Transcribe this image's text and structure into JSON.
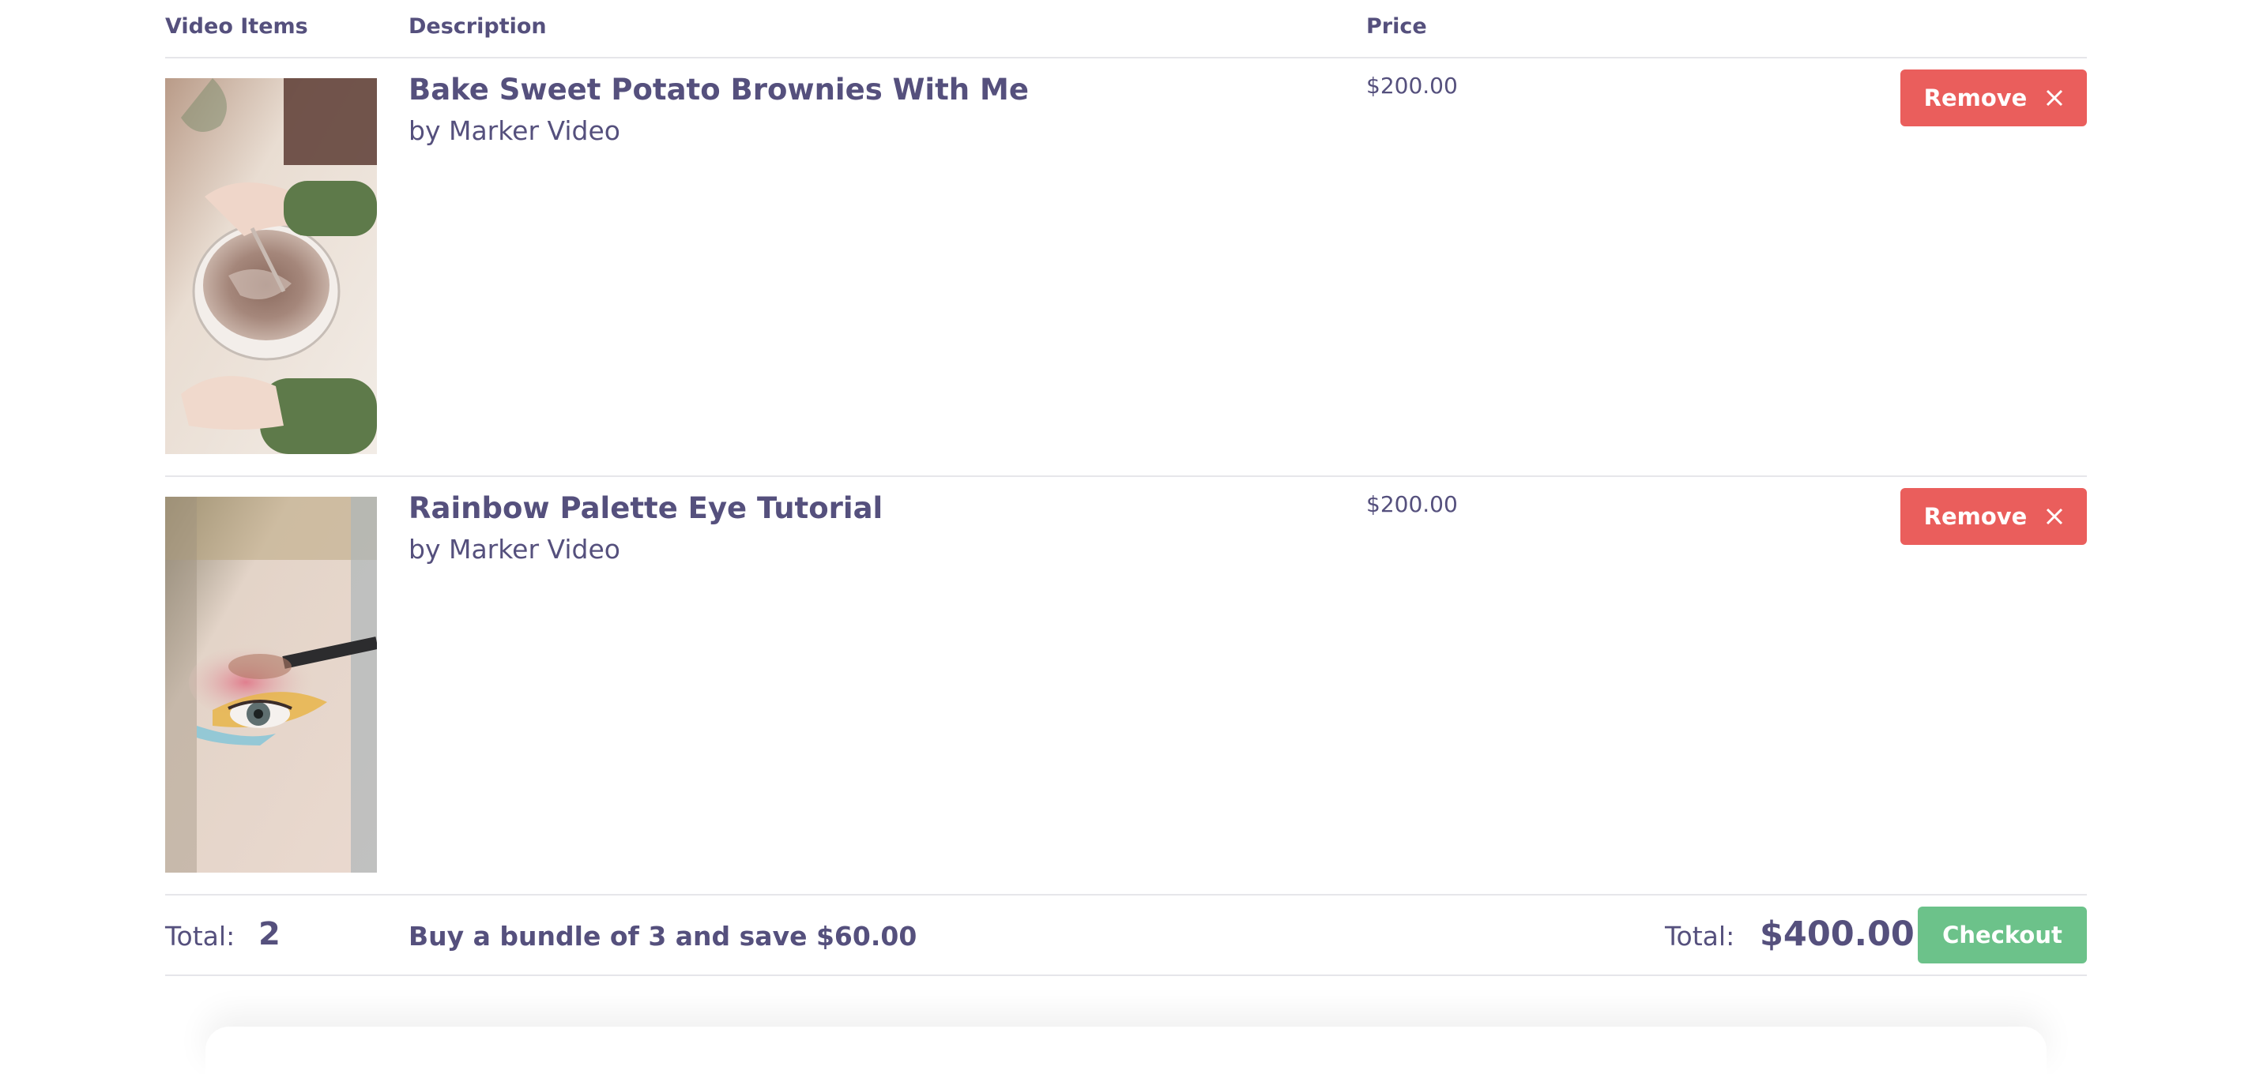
{
  "header": {
    "items_label": "Video Items",
    "description_label": "Description",
    "price_label": "Price"
  },
  "items": [
    {
      "title": "Bake Sweet Potato Brownies With Me",
      "author": "by Marker Video",
      "price": "$200.00",
      "remove_label": "Remove",
      "thumbnail_icon": "brownie-batter-bowl-image"
    },
    {
      "title": "Rainbow Palette Eye Tutorial",
      "author": "by Marker Video",
      "price": "$200.00",
      "remove_label": "Remove",
      "thumbnail_icon": "eye-makeup-image"
    }
  ],
  "footer": {
    "total_label": "Total:",
    "total_count": "2",
    "bundle_text": "Buy a bundle of 3 and save $60.00",
    "sum_label": "Total:",
    "sum_value": "$400.00",
    "checkout_label": "Checkout"
  },
  "colors": {
    "text": "#55507d",
    "remove": "#ea5e5c",
    "checkout": "#6cc28a",
    "divider": "#e6e6ea"
  }
}
